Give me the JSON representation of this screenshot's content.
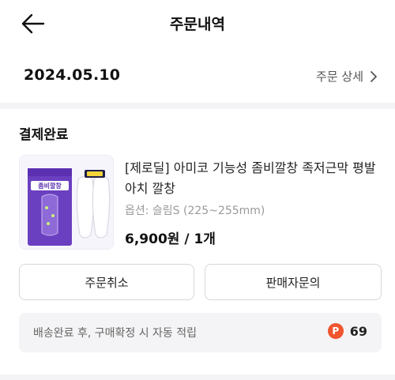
{
  "header": {
    "title": "주문내역",
    "back_icon": "arrow-left-icon"
  },
  "order": {
    "date": "2024.05.10",
    "detail_label": "주문 상세",
    "detail_icon": "chevron-right-icon"
  },
  "status": "결제완료",
  "product": {
    "title": "[제로딜] 아미코 기능성 좀비깔창 족저근막 평발 아치 깔창",
    "option": "옵션: 슬림S (225~255mm)",
    "price": "6,900원 / 1개",
    "thumb_label": "좀비깔창"
  },
  "actions": {
    "cancel_label": "주문취소",
    "inquiry_label": "판매자문의"
  },
  "points": {
    "text": "배송완료 후, 구매확정 시 자동 적립",
    "badge": "P",
    "value": "69",
    "badge_color": "#f0552f"
  }
}
